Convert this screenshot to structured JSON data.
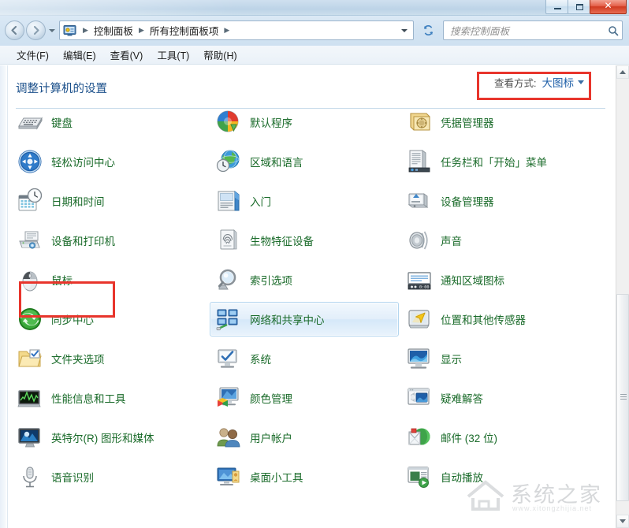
{
  "window": {
    "buttons": {
      "minimize": "minimize",
      "maximize": "restore",
      "close": "✕"
    }
  },
  "navbar": {
    "back": "back-arrow",
    "forward": "forward-arrow",
    "history_dropdown": "recent-locations",
    "breadcrumbs": [
      "控制面板",
      "所有控制面板项"
    ],
    "separator": "▶",
    "address_dropdown": "▼",
    "refresh": "refresh-icon",
    "search": {
      "placeholder": "搜索控制面板",
      "value": "",
      "icon": "search-icon"
    }
  },
  "menubar": {
    "items": [
      {
        "label": "文件(F)"
      },
      {
        "label": "编辑(E)"
      },
      {
        "label": "查看(V)"
      },
      {
        "label": "工具(T)"
      },
      {
        "label": "帮助(H)"
      }
    ]
  },
  "page": {
    "title": "调整计算机的设置",
    "viewby_label": "查看方式:",
    "viewby_value": "大图标"
  },
  "grid": {
    "columns": 3,
    "items": [
      {
        "label": "键盘",
        "icon": "keyboard-icon",
        "col": 0,
        "row": 0,
        "selected": false
      },
      {
        "label": "轻松访问中心",
        "icon": "ease-of-access-icon",
        "col": 0,
        "row": 1,
        "selected": false
      },
      {
        "label": "日期和时间",
        "icon": "date-time-icon",
        "col": 0,
        "row": 2,
        "selected": false
      },
      {
        "label": "设备和打印机",
        "icon": "devices-printers-icon",
        "col": 0,
        "row": 3,
        "selected": false
      },
      {
        "label": "鼠标",
        "icon": "mouse-icon",
        "col": 0,
        "row": 4,
        "selected": false
      },
      {
        "label": "同步中心",
        "icon": "sync-center-icon",
        "col": 0,
        "row": 5,
        "selected": false
      },
      {
        "label": "文件夹选项",
        "icon": "folder-options-icon",
        "col": 0,
        "row": 6,
        "selected": false
      },
      {
        "label": "性能信息和工具",
        "icon": "performance-icon",
        "col": 0,
        "row": 7,
        "selected": false
      },
      {
        "label": "英特尔(R) 图形和媒体",
        "icon": "intel-graphics-icon",
        "col": 0,
        "row": 8,
        "selected": false
      },
      {
        "label": "语音识别",
        "icon": "speech-recognition-icon",
        "col": 0,
        "row": 9,
        "selected": false
      },
      {
        "label": "默认程序",
        "icon": "default-programs-icon",
        "col": 1,
        "row": 0,
        "selected": false
      },
      {
        "label": "区域和语言",
        "icon": "region-language-icon",
        "col": 1,
        "row": 1,
        "selected": false
      },
      {
        "label": "入门",
        "icon": "getting-started-icon",
        "col": 1,
        "row": 2,
        "selected": false
      },
      {
        "label": "生物特征设备",
        "icon": "biometric-devices-icon",
        "col": 1,
        "row": 3,
        "selected": false
      },
      {
        "label": "索引选项",
        "icon": "indexing-options-icon",
        "col": 1,
        "row": 4,
        "selected": false
      },
      {
        "label": "网络和共享中心",
        "icon": "network-sharing-icon",
        "col": 1,
        "row": 5,
        "selected": true
      },
      {
        "label": "系统",
        "icon": "system-icon",
        "col": 1,
        "row": 6,
        "selected": false
      },
      {
        "label": "颜色管理",
        "icon": "color-management-icon",
        "col": 1,
        "row": 7,
        "selected": false
      },
      {
        "label": "用户帐户",
        "icon": "user-accounts-icon",
        "col": 1,
        "row": 8,
        "selected": false
      },
      {
        "label": "桌面小工具",
        "icon": "desktop-gadgets-icon",
        "col": 1,
        "row": 9,
        "selected": false
      },
      {
        "label": "凭据管理器",
        "icon": "credential-manager-icon",
        "col": 2,
        "row": 0,
        "selected": false
      },
      {
        "label": "任务栏和「开始」菜单",
        "icon": "taskbar-startmenu-icon",
        "col": 2,
        "row": 1,
        "selected": false
      },
      {
        "label": "设备管理器",
        "icon": "device-manager-icon",
        "col": 2,
        "row": 2,
        "selected": false
      },
      {
        "label": "声音",
        "icon": "sound-icon",
        "col": 2,
        "row": 3,
        "selected": false
      },
      {
        "label": "通知区域图标",
        "icon": "notification-area-icon",
        "col": 2,
        "row": 4,
        "selected": false
      },
      {
        "label": "位置和其他传感器",
        "icon": "location-sensors-icon",
        "col": 2,
        "row": 5,
        "selected": false
      },
      {
        "label": "显示",
        "icon": "display-icon",
        "col": 2,
        "row": 6,
        "selected": false
      },
      {
        "label": "疑难解答",
        "icon": "troubleshooting-icon",
        "col": 2,
        "row": 7,
        "selected": false
      },
      {
        "label": "邮件 (32 位)",
        "icon": "mail-icon",
        "col": 2,
        "row": 8,
        "selected": false
      },
      {
        "label": "自动播放",
        "icon": "autoplay-icon",
        "col": 2,
        "row": 9,
        "selected": false
      }
    ]
  },
  "scrollbar": {
    "up_arrow": "▲",
    "down_arrow": "▼"
  },
  "annotations": {
    "viewby_highlight_color": "#e8352c",
    "mouse_highlight_color": "#e8352c"
  },
  "watermark": {
    "text": "系统之家",
    "subtext": "www.xitongzhijia.net"
  },
  "colors": {
    "label_green": "#1a6b2a",
    "title_blue": "#1a4f8a",
    "link_blue": "#1e5fa8",
    "accent_red": "#e8352c",
    "selection_border": "#b3d5ef"
  }
}
